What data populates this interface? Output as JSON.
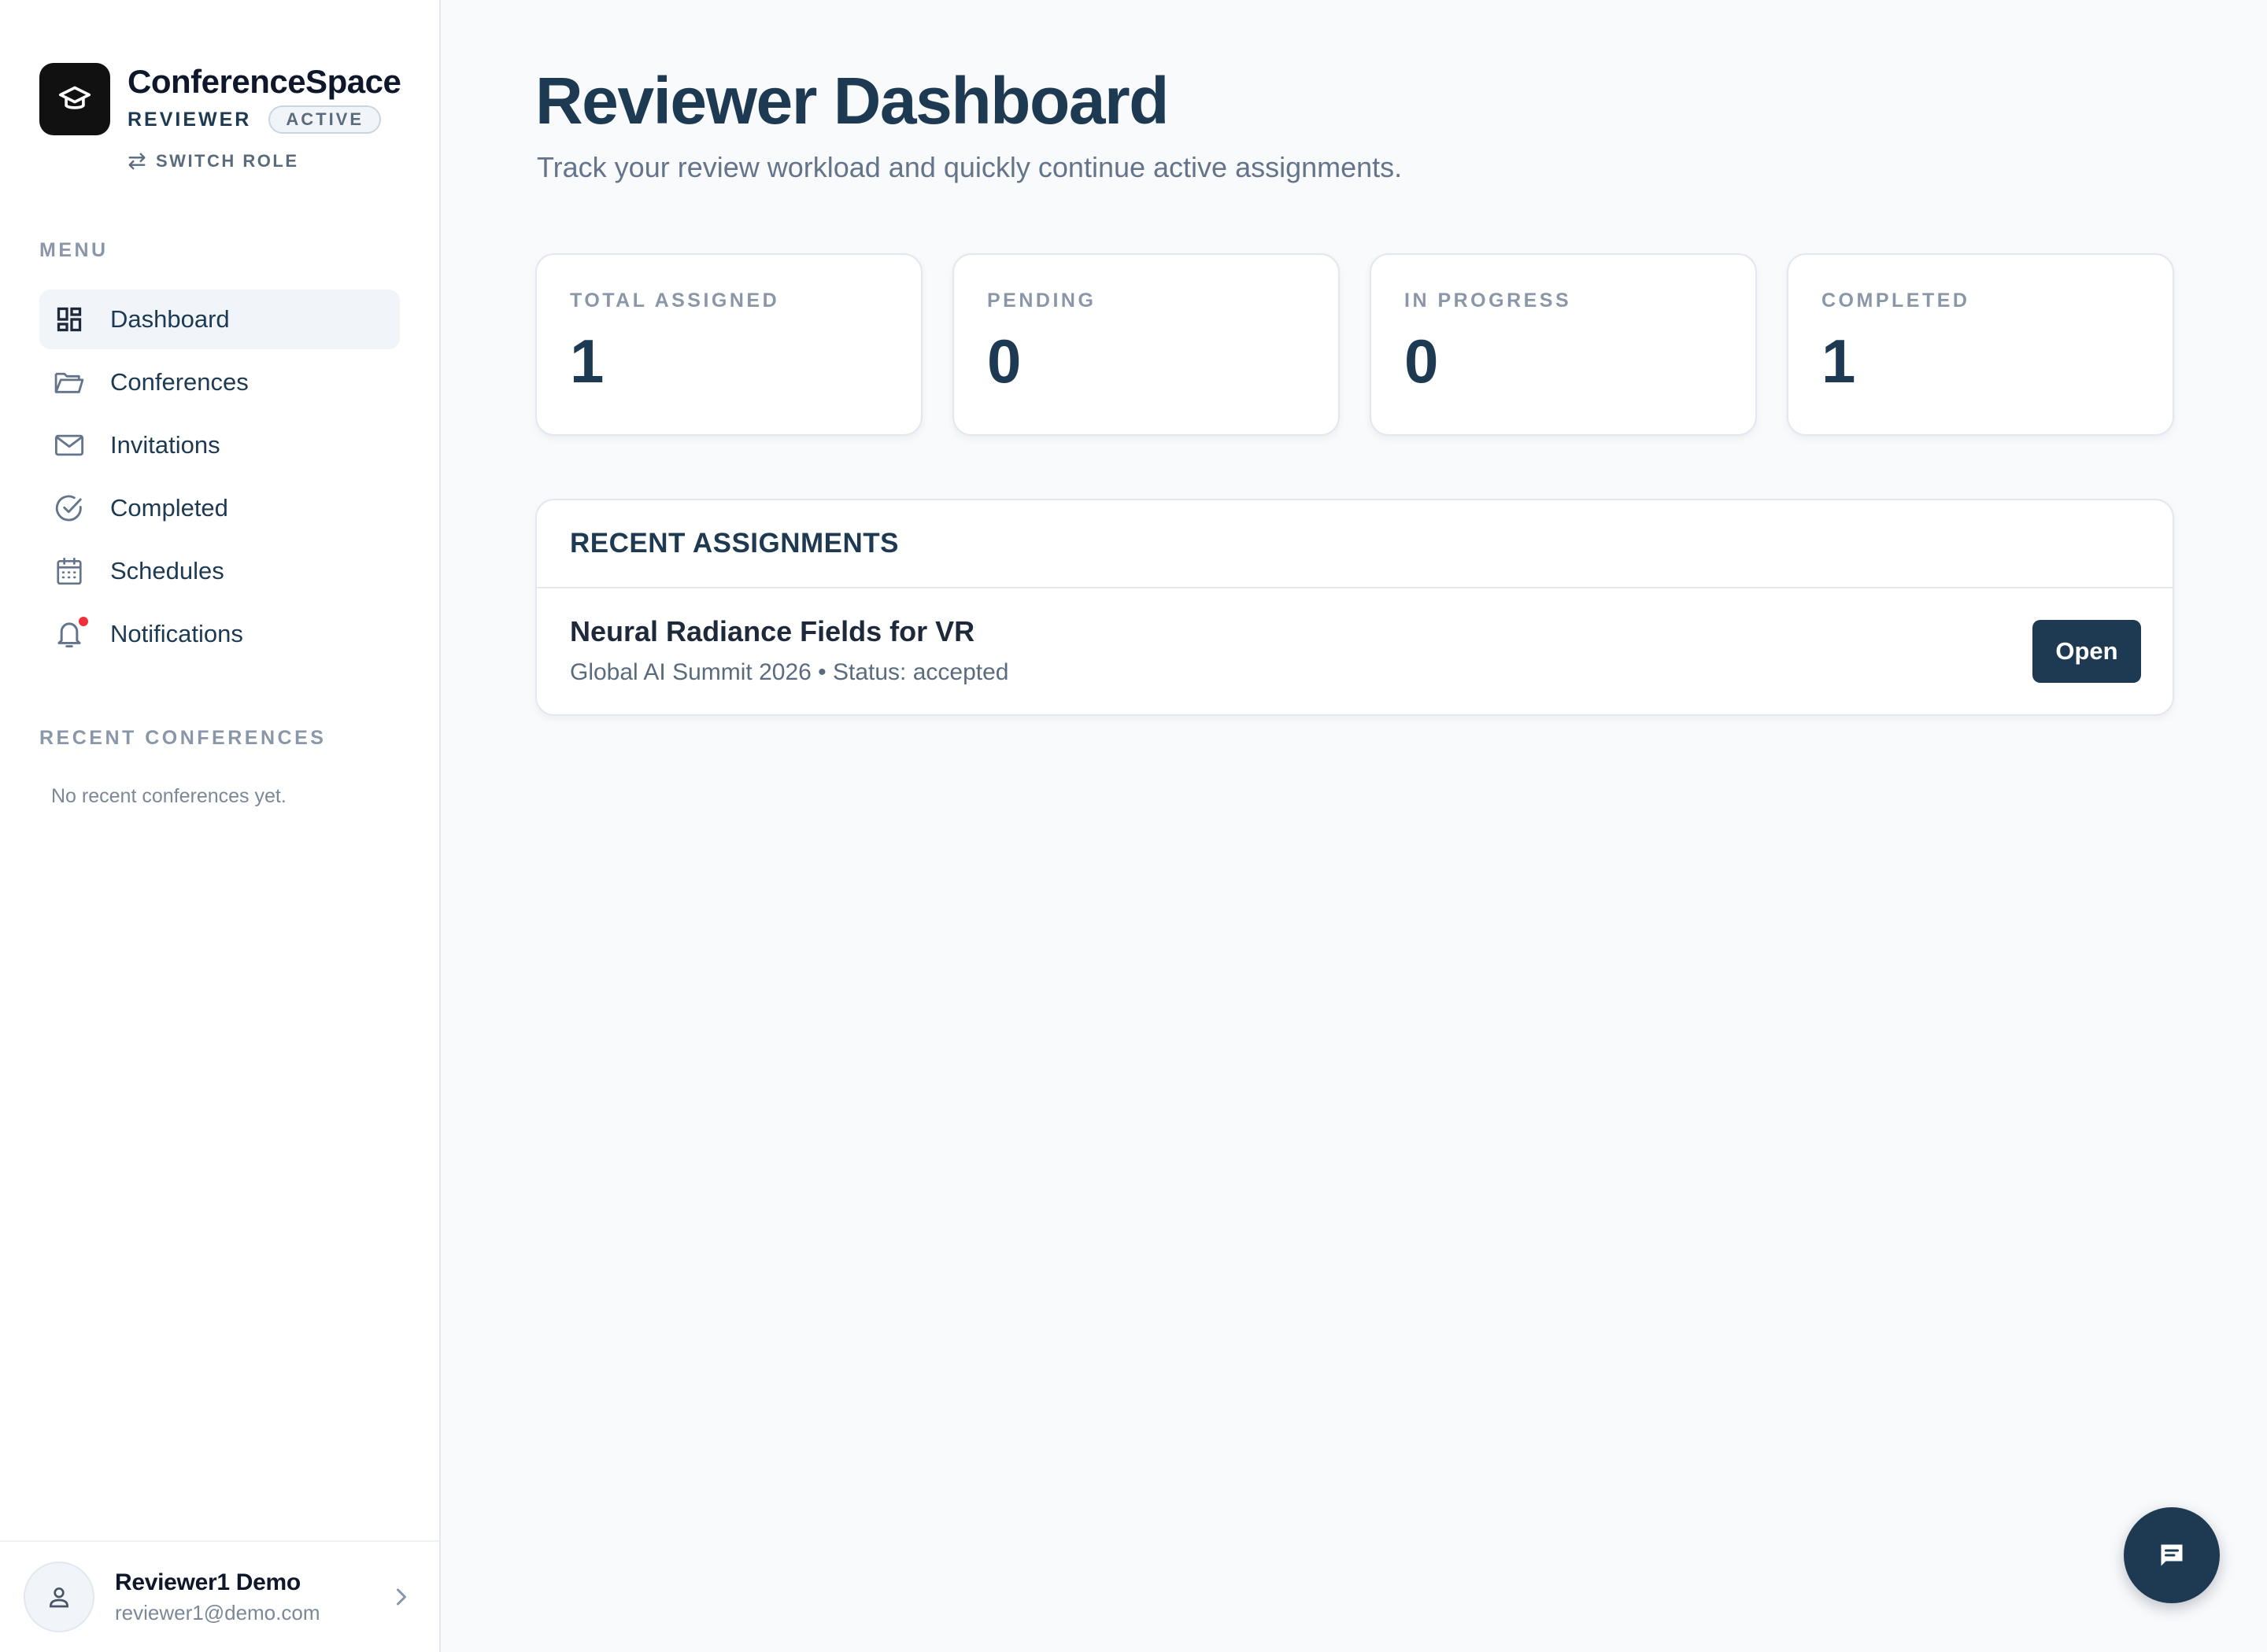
{
  "brand": {
    "name": "ConferenceSpace",
    "role": "REVIEWER",
    "status_badge": "ACTIVE",
    "switch_role_label": "SWITCH ROLE"
  },
  "sidebar": {
    "menu_label": "MENU",
    "items": [
      {
        "label": "Dashboard",
        "icon": "dashboard-icon",
        "active": true
      },
      {
        "label": "Conferences",
        "icon": "folder-icon",
        "active": false
      },
      {
        "label": "Invitations",
        "icon": "mail-icon",
        "active": false
      },
      {
        "label": "Completed",
        "icon": "check-circle-icon",
        "active": false
      },
      {
        "label": "Schedules",
        "icon": "calendar-icon",
        "active": false
      },
      {
        "label": "Notifications",
        "icon": "bell-icon",
        "active": false,
        "has_unread": true
      }
    ],
    "recent_label": "RECENT CONFERENCES",
    "recent_empty": "No recent conferences yet."
  },
  "user": {
    "name": "Reviewer1 Demo",
    "email": "reviewer1@demo.com"
  },
  "main": {
    "title": "Reviewer Dashboard",
    "subtitle": "Track your review workload and quickly continue active assignments.",
    "stats": [
      {
        "label": "TOTAL ASSIGNED",
        "value": "1"
      },
      {
        "label": "PENDING",
        "value": "0"
      },
      {
        "label": "IN PROGRESS",
        "value": "0"
      },
      {
        "label": "COMPLETED",
        "value": "1"
      }
    ],
    "recent_assignments": {
      "heading": "RECENT ASSIGNMENTS",
      "items": [
        {
          "title": "Neural Radiance Fields for VR",
          "meta": "Global AI Summit 2026 • Status: accepted",
          "action_label": "Open"
        }
      ]
    }
  },
  "colors": {
    "primary": "#1e3a52",
    "sidebar_active_bg": "#f1f5f9",
    "notification_dot": "#ef2f3a",
    "page_bg": "#f8fafc"
  }
}
